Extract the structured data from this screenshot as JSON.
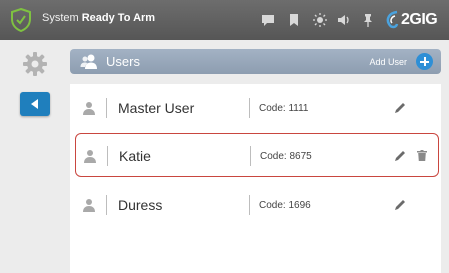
{
  "status_bar": {
    "prefix": "System ",
    "state": "Ready To Arm",
    "brand": "2GIG",
    "icons": [
      "shield-check-icon",
      "message-icon",
      "bookmark-icon",
      "brightness-icon",
      "volume-icon",
      "pin-icon"
    ]
  },
  "sidebar": {
    "icons": [
      "gear-icon",
      "back-arrow-icon"
    ]
  },
  "users_header": {
    "title": "Users",
    "add_label": "Add User",
    "icons": [
      "users-icon",
      "plus-icon"
    ]
  },
  "users": [
    {
      "name": "Master User",
      "code": "Code: 1111",
      "selected": false
    },
    {
      "name": "Katie",
      "code": "Code: 8675",
      "selected": true
    },
    {
      "name": "Duress",
      "code": "Code: 1696",
      "selected": false
    }
  ],
  "colors": {
    "status_bar": "#5e5e5e",
    "accent_blue": "#1f7fbd",
    "header": "#98a8bb",
    "selection_border": "#c9463f",
    "shield_green": "#7fc241"
  }
}
